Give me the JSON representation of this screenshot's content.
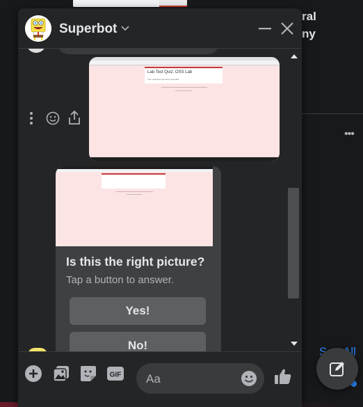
{
  "background": {
    "side_text_line1": "ral",
    "side_text_line2": "ny",
    "more_glyph": "•••",
    "see_all": "See All"
  },
  "chat": {
    "title": "Superbot",
    "screenshot1": {
      "quiz_title": "Lab Test Quiz: OSS Lab",
      "quiz_sub": "Your response has been recorded."
    },
    "prompt": {
      "title": "Is this the right picture?",
      "subtitle": "Tap a button to answer."
    },
    "quick_replies": [
      {
        "label": "Yes!"
      },
      {
        "label": "No!"
      }
    ],
    "composer": {
      "placeholder": "Aa"
    }
  },
  "colors": {
    "accent": "#2d88ff",
    "window_bg": "#242526",
    "button_bg": "#5e5f61"
  },
  "icons": {
    "composer": [
      "plus-circle-icon",
      "photo-icon",
      "sticker-icon",
      "gif-icon",
      "emoji-icon",
      "thumbs-up-icon"
    ],
    "header": [
      "chevron-down-icon",
      "minimize-icon",
      "close-icon"
    ],
    "message_actions": [
      "more-vertical-icon",
      "react-emoji-icon",
      "share-icon"
    ],
    "fab": "compose-icon"
  }
}
